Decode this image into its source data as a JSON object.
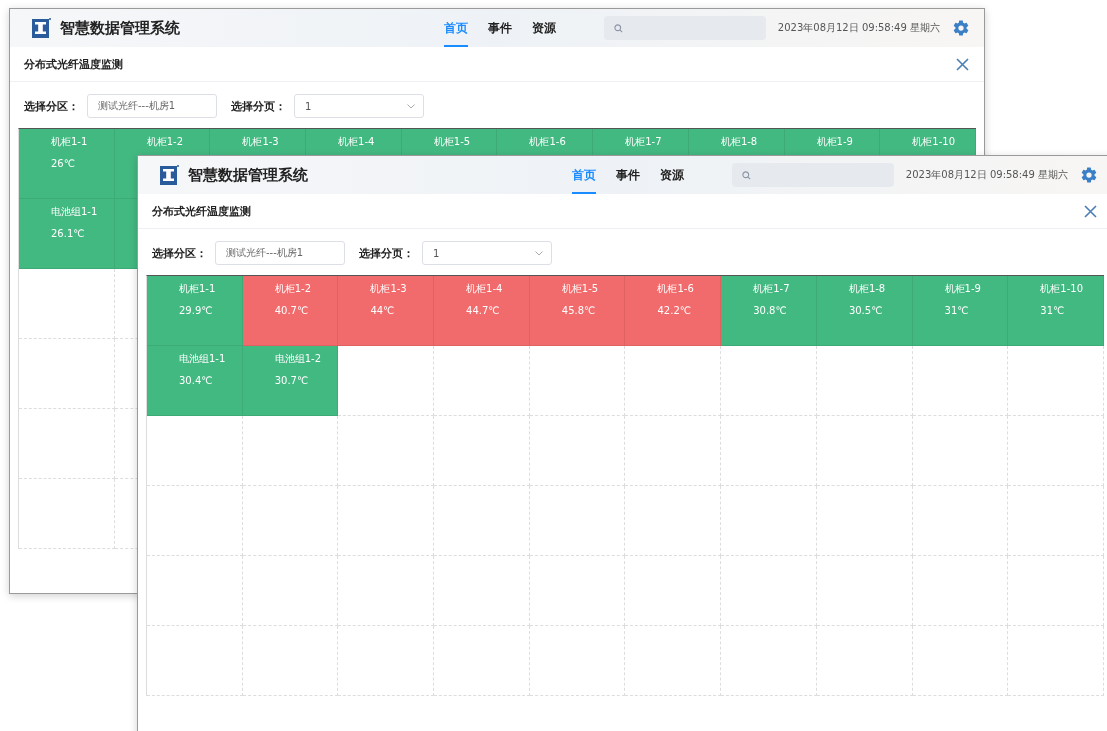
{
  "windows": [
    {
      "app_title": "智慧数据管理系统",
      "nav": [
        {
          "label": "首页",
          "selected": true
        },
        {
          "label": "事件",
          "selected": false
        },
        {
          "label": "资源",
          "selected": false
        }
      ],
      "datetime": "2023年08月12日 09:58:49 星期六",
      "panel_title": "分布式光纤温度监测",
      "filters": [
        {
          "label": "选择分区：",
          "kind": "text",
          "value": "测试光纤---机房1"
        },
        {
          "label": "选择分页：",
          "kind": "select",
          "value": "1"
        }
      ],
      "cells": [
        {
          "name": "机柜1-1",
          "temp": "26℃",
          "alarm": false
        },
        {
          "name": "机柜1-2",
          "alarm": false
        },
        {
          "name": "机柜1-3",
          "alarm": false
        },
        {
          "name": "机柜1-4",
          "alarm": false
        },
        {
          "name": "机柜1-5",
          "alarm": false
        },
        {
          "name": "机柜1-6",
          "alarm": false
        },
        {
          "name": "机柜1-7",
          "alarm": false
        },
        {
          "name": "机柜1-8",
          "alarm": false
        },
        {
          "name": "机柜1-9",
          "alarm": false
        },
        {
          "name": "机柜1-10",
          "alarm": false
        },
        {
          "name": "电池组1-1",
          "temp": "26.1℃",
          "alarm": false
        },
        {
          "alarm": false
        }
      ]
    },
    {
      "app_title": "智慧数据管理系统",
      "nav": [
        {
          "label": "首页",
          "selected": true
        },
        {
          "label": "事件",
          "selected": false
        },
        {
          "label": "资源",
          "selected": false
        }
      ],
      "datetime": "2023年08月12日 09:58:49 星期六",
      "panel_title": "分布式光纤温度监测",
      "filters": [
        {
          "label": "选择分区：",
          "kind": "text",
          "value": "测试光纤---机房1"
        },
        {
          "label": "选择分页：",
          "kind": "select",
          "value": "1"
        }
      ],
      "cells": [
        {
          "name": "机柜1-1",
          "temp": "29.9℃",
          "alarm": false
        },
        {
          "name": "机柜1-2",
          "temp": "40.7℃",
          "alarm": true
        },
        {
          "name": "机柜1-3",
          "temp": "44℃",
          "alarm": true
        },
        {
          "name": "机柜1-4",
          "temp": "44.7℃",
          "alarm": true
        },
        {
          "name": "机柜1-5",
          "temp": "45.8℃",
          "alarm": true
        },
        {
          "name": "机柜1-6",
          "temp": "42.2℃",
          "alarm": true
        },
        {
          "name": "机柜1-7",
          "temp": "30.8℃",
          "alarm": false
        },
        {
          "name": "机柜1-8",
          "temp": "30.5℃",
          "alarm": false
        },
        {
          "name": "机柜1-9",
          "temp": "31℃",
          "alarm": false
        },
        {
          "name": "机柜1-10",
          "temp": "31℃",
          "alarm": false
        },
        {
          "name": "电池组1-1",
          "temp": "30.4℃",
          "alarm": false
        },
        {
          "name": "电池组1-2",
          "temp": "30.7℃",
          "alarm": false
        }
      ]
    }
  ]
}
